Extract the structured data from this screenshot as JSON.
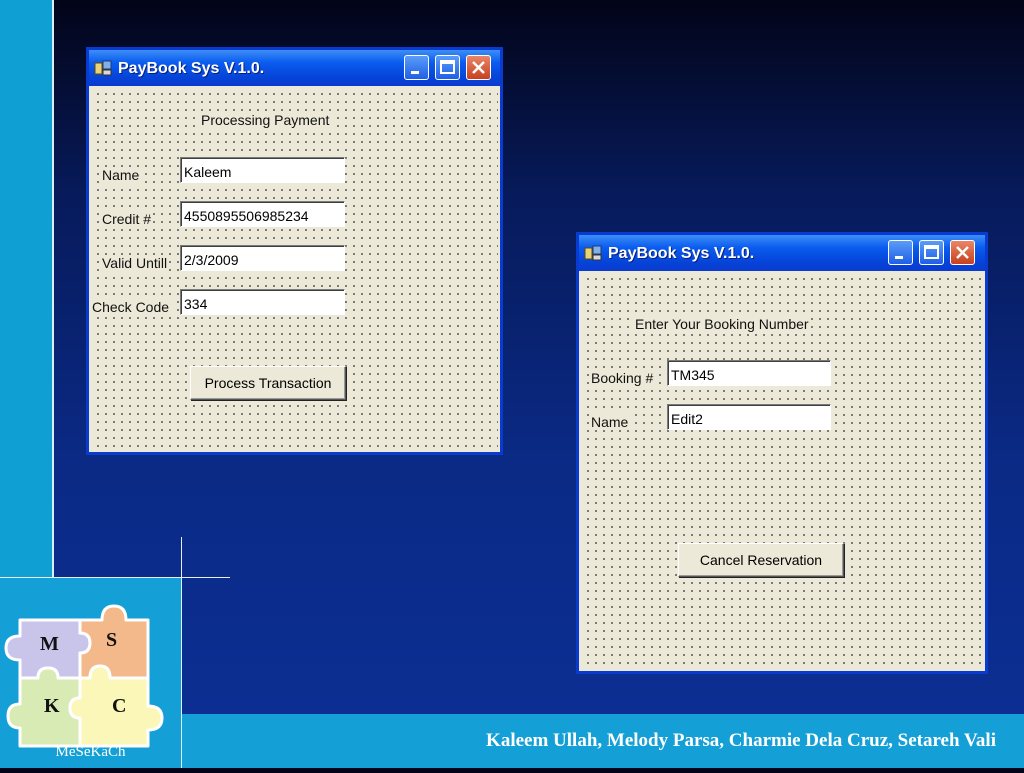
{
  "slide": {
    "footer_text": "Kaleem Ullah, Melody Parsa, Charmie Dela Cruz, Setareh Vali",
    "logo_label": "MeSeKaCh",
    "logo_letters": [
      "M",
      "S",
      "K",
      "C"
    ]
  },
  "windows": [
    {
      "title": "PayBook Sys V.1.0.",
      "heading": "Processing Payment",
      "fields": [
        {
          "label": "Name",
          "value": "Kaleem"
        },
        {
          "label": "Credit #",
          "value": "4550895506985234"
        },
        {
          "label": "Valid Untill",
          "value": "2/3/2009"
        },
        {
          "label": "Check Code",
          "value": "334"
        }
      ],
      "button": "Process Transaction"
    },
    {
      "title": "PayBook Sys V.1.0.",
      "heading": "Enter Your Booking Number",
      "fields": [
        {
          "label": "Booking #",
          "value": "TM345"
        },
        {
          "label": "Name",
          "value": "Edit2"
        }
      ],
      "button": "Cancel Reservation"
    }
  ],
  "colors": {
    "accent_bar": "#0f9fd2",
    "title_bar": "#0a5cf0",
    "form_bg": "#ece9d8",
    "close_button": "#c8401d"
  },
  "icons": [
    "app-icon",
    "minimize-icon",
    "maximize-icon",
    "close-icon",
    "puzzle-logo-icon"
  ]
}
